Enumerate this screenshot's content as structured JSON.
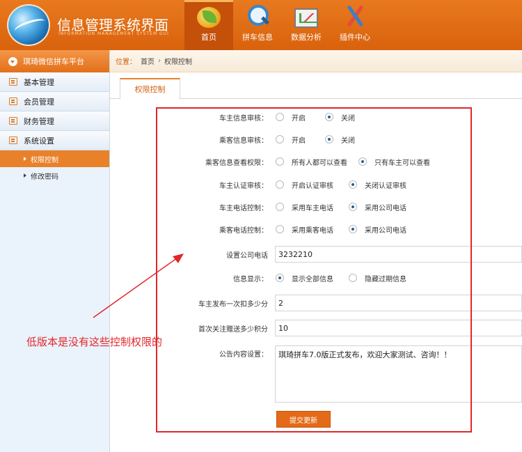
{
  "header": {
    "title": "信息管理系统界面",
    "subtitle": "INFORMATION MANAGEMENT SYSTEM GUI",
    "nav": [
      {
        "label": "首页",
        "icon": "home-icon",
        "active": true
      },
      {
        "label": "拼车信息",
        "icon": "search-icon",
        "active": false
      },
      {
        "label": "数据分析",
        "icon": "chart-icon",
        "active": false
      },
      {
        "label": "插件中心",
        "icon": "tools-icon",
        "active": false
      }
    ]
  },
  "sidebar": {
    "title": "琪琦微信拼车平台",
    "items": [
      {
        "label": "基本管理",
        "icon": "note-icon"
      },
      {
        "label": "会员管理",
        "icon": "note-icon"
      },
      {
        "label": "财务管理",
        "icon": "note-icon"
      },
      {
        "label": "系统设置",
        "icon": "note-icon"
      }
    ],
    "sub_items": [
      {
        "label": "权限控制",
        "active": true
      },
      {
        "label": "修改密码",
        "active": false
      }
    ]
  },
  "breadcrumb": {
    "prefix": "位置：",
    "items": [
      "首页",
      "权限控制"
    ]
  },
  "tab": {
    "label": "权限控制"
  },
  "form": {
    "radio_rows": [
      {
        "label": "车主信息审核：",
        "options": [
          "开启",
          "关闭"
        ],
        "selected": 1
      },
      {
        "label": "乘客信息审核：",
        "options": [
          "开启",
          "关闭"
        ],
        "selected": 1
      },
      {
        "label": "乘客信息查看权限：",
        "options": [
          "所有人都可以查看",
          "只有车主可以查看"
        ],
        "selected": 1
      },
      {
        "label": "车主认证审核：",
        "options": [
          "开启认证审核",
          "关闭认证审核"
        ],
        "selected": 1
      },
      {
        "label": "车主电话控制：",
        "options": [
          "采用车主电话",
          "采用公司电话"
        ],
        "selected": 1
      },
      {
        "label": "乘客电话控制：",
        "options": [
          "采用乘客电话",
          "采用公司电话"
        ],
        "selected": 1
      }
    ],
    "company_phone": {
      "label": "设置公司电话",
      "value": "3232210"
    },
    "info_display": {
      "label": "信息显示：",
      "options": [
        "显示全部信息",
        "隐藏过期信息"
      ],
      "selected": 0
    },
    "publish_deduct": {
      "label": "车主发布一次扣多少分",
      "value": "2"
    },
    "first_follow": {
      "label": "首次关注赠送多少积分",
      "value": "10"
    },
    "notice": {
      "label": "公告内容设置：",
      "value": "琪琦拼车7.0版正式发布，欢迎大家测试、咨询！！"
    },
    "submit_label": "提交更新"
  },
  "annotation": {
    "text": "低版本是没有这些控制权限的",
    "color": "#e3262a"
  },
  "colors": {
    "accent": "#e8812a",
    "header": "#e0701a",
    "annotation_red": "#e3262a"
  }
}
